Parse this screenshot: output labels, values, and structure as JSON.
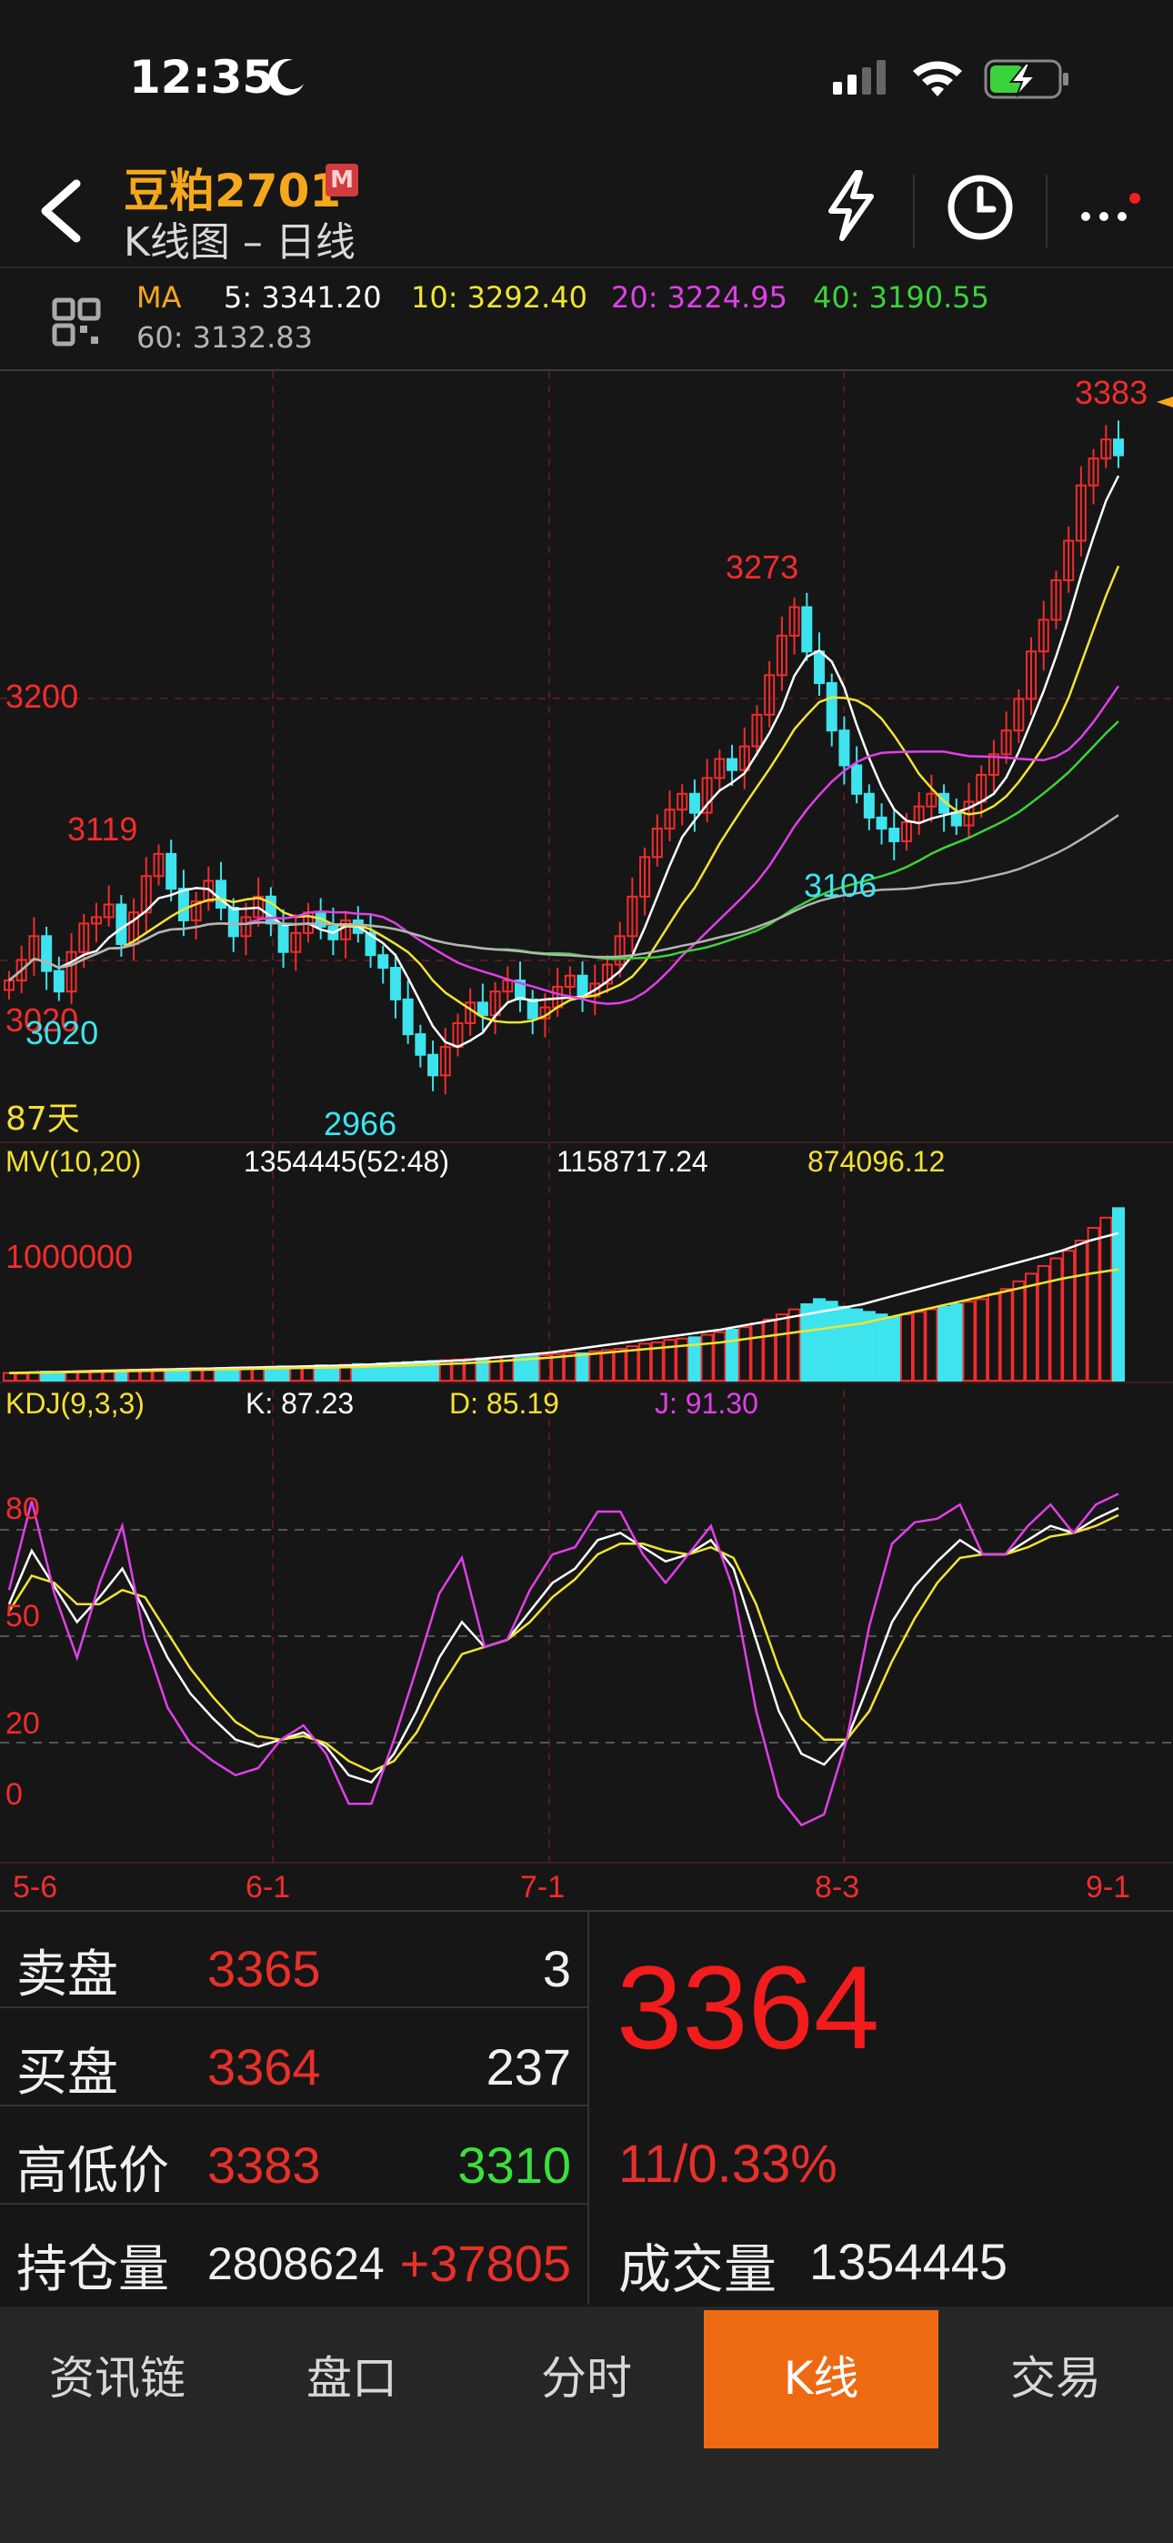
{
  "status": {
    "time": "12:35"
  },
  "header": {
    "title": "豆粕2701",
    "badge": "M",
    "subtitle": "K线图 – 日线"
  },
  "ma_legend": {
    "label": "MA",
    "ma5": "5: 3341.20",
    "ma10": "10: 3292.40",
    "ma20": "20: 3224.95",
    "ma40": "40: 3190.55",
    "ma60": "60: 3132.83",
    "colors": {
      "ma5": "#ffffff",
      "ma10": "#f0e432",
      "ma20": "#e040e8",
      "ma40": "#3cd23c",
      "ma60": "#b4b4b4"
    }
  },
  "chart_data": [
    {
      "type": "candlestick",
      "price_labels": {
        "level": "3200",
        "days": "87天",
        "high": "3383",
        "peak1": "3273",
        "peak2": "3119",
        "low": "2966",
        "low2": "3106",
        "left1": "3020",
        "left2": "3020"
      },
      "ylim": [
        2940,
        3400
      ],
      "x_labels": [
        "5-6",
        "6-1",
        "7-1",
        "8-3",
        "9-1"
      ],
      "close": [
        3032,
        3045,
        3060,
        3038,
        3025,
        3050,
        3068,
        3072,
        3080,
        3055,
        3075,
        3098,
        3112,
        3090,
        3070,
        3082,
        3095,
        3078,
        3060,
        3072,
        3085,
        3068,
        3050,
        3062,
        3075,
        3066,
        3058,
        3070,
        3062,
        3048,
        3040,
        3020,
        2998,
        2985,
        2972,
        2990,
        3005,
        3018,
        3010,
        3025,
        3032,
        3020,
        3008,
        3015,
        3028,
        3035,
        3022,
        3030,
        3042,
        3060,
        3085,
        3110,
        3128,
        3140,
        3150,
        3138,
        3160,
        3172,
        3165,
        3180,
        3200,
        3225,
        3250,
        3268,
        3240,
        3220,
        3190,
        3168,
        3150,
        3135,
        3128,
        3120,
        3132,
        3142,
        3150,
        3138,
        3130,
        3145,
        3162,
        3175,
        3190,
        3210,
        3240,
        3260,
        3285,
        3310,
        3345,
        3362,
        3374,
        3364
      ]
    },
    {
      "type": "bar",
      "title": "MV(10,20)",
      "labels": {
        "vol": "1354445(52:48)",
        "ma10": "1158717.24",
        "ma20": "874096.12",
        "axis": "1000000"
      },
      "ylim": [
        0,
        1500000
      ],
      "values": [
        60000,
        55000,
        62000,
        70000,
        66000,
        72000,
        75000,
        78000,
        82000,
        80000,
        85000,
        88000,
        92000,
        90000,
        94000,
        98000,
        96000,
        99000,
        102000,
        105000,
        100000,
        108000,
        112000,
        110000,
        115000,
        120000,
        118000,
        125000,
        130000,
        128000,
        135000,
        140000,
        145000,
        150000,
        155000,
        160000,
        165000,
        170000,
        175000,
        180000,
        190000,
        185000,
        195000,
        200000,
        210000,
        220000,
        215000,
        230000,
        240000,
        250000,
        270000,
        290000,
        300000,
        320000,
        330000,
        340000,
        360000,
        380000,
        400000,
        420000,
        450000,
        480000,
        520000,
        560000,
        600000,
        640000,
        620000,
        580000,
        560000,
        540000,
        520000,
        500000,
        520000,
        540000,
        560000,
        580000,
        600000,
        620000,
        640000,
        680000,
        720000,
        780000,
        840000,
        900000,
        960000,
        1020000,
        1100000,
        1200000,
        1280000,
        1354445
      ],
      "ma10": [
        60000,
        65000,
        70000,
        75000,
        80000,
        85000,
        90000,
        95000,
        100000,
        105000,
        110000,
        115000,
        120000,
        130000,
        140000,
        150000,
        160000,
        180000,
        200000,
        220000,
        250000,
        280000,
        310000,
        340000,
        370000,
        400000,
        440000,
        480000,
        520000,
        560000,
        600000,
        660000,
        720000,
        780000,
        840000,
        900000,
        960000,
        1020000,
        1100000,
        1158717
      ],
      "ma20": [
        60000,
        62000,
        66000,
        70000,
        74000,
        78000,
        82000,
        86000,
        90000,
        94000,
        98000,
        102000,
        106000,
        112000,
        120000,
        128000,
        136000,
        150000,
        165000,
        180000,
        200000,
        220000,
        240000,
        260000,
        280000,
        300000,
        330000,
        360000,
        390000,
        420000,
        450000,
        500000,
        550000,
        600000,
        650000,
        700000,
        750000,
        800000,
        840000,
        874096
      ]
    },
    {
      "type": "line",
      "title": "KDJ(9,3,3)",
      "labels": {
        "k": "K: 87.23",
        "d": "D: 85.19",
        "j": "J: 91.30",
        "l80": "80",
        "l50": "50",
        "l20": "20",
        "l0": "0"
      },
      "ylim": [
        -10,
        110
      ],
      "series": [
        {
          "key": "K",
          "color": "#ffffff",
          "values": [
            60,
            75,
            65,
            55,
            62,
            70,
            58,
            45,
            35,
            28,
            22,
            20,
            22,
            24,
            20,
            12,
            10,
            18,
            30,
            45,
            55,
            48,
            50,
            58,
            66,
            70,
            78,
            80,
            76,
            72,
            74,
            78,
            70,
            50,
            30,
            18,
            15,
            22,
            38,
            55,
            65,
            72,
            78,
            74,
            74,
            78,
            82,
            80,
            84,
            87
          ]
        },
        {
          "key": "D",
          "color": "#f0e432",
          "values": [
            58,
            68,
            66,
            60,
            60,
            64,
            62,
            52,
            42,
            34,
            27,
            23,
            22,
            23,
            21,
            16,
            13,
            16,
            24,
            36,
            46,
            48,
            50,
            55,
            62,
            67,
            74,
            77,
            77,
            75,
            74,
            76,
            73,
            60,
            42,
            28,
            22,
            22,
            30,
            44,
            56,
            66,
            73,
            74,
            74,
            76,
            79,
            80,
            82,
            85
          ]
        },
        {
          "key": "J",
          "color": "#e040e8",
          "values": [
            64,
            89,
            63,
            45,
            66,
            82,
            50,
            31,
            21,
            16,
            12,
            14,
            22,
            26,
            18,
            4,
            4,
            22,
            42,
            63,
            73,
            48,
            50,
            64,
            74,
            76,
            86,
            86,
            74,
            66,
            74,
            82,
            64,
            30,
            6,
            -2,
            1,
            22,
            54,
            77,
            83,
            84,
            88,
            74,
            74,
            82,
            88,
            80,
            88,
            91
          ]
        }
      ]
    }
  ],
  "quote": {
    "ask_label": "卖盘",
    "ask_price": "3365",
    "ask_qty": "3",
    "bid_label": "买盘",
    "bid_price": "3364",
    "bid_qty": "237",
    "hl_label": "高低价",
    "high": "3383",
    "low": "3310",
    "oi_label": "持仓量",
    "oi": "2808624",
    "oi_change": "+37805",
    "last": "3364",
    "change": "11/0.33%",
    "volume_label": "成交量",
    "volume": "1354445"
  },
  "tabs": [
    {
      "label": "资讯链",
      "active": false
    },
    {
      "label": "盘口",
      "active": false
    },
    {
      "label": "分时",
      "active": false
    },
    {
      "label": "K线",
      "active": true
    },
    {
      "label": "交易",
      "active": false
    }
  ]
}
